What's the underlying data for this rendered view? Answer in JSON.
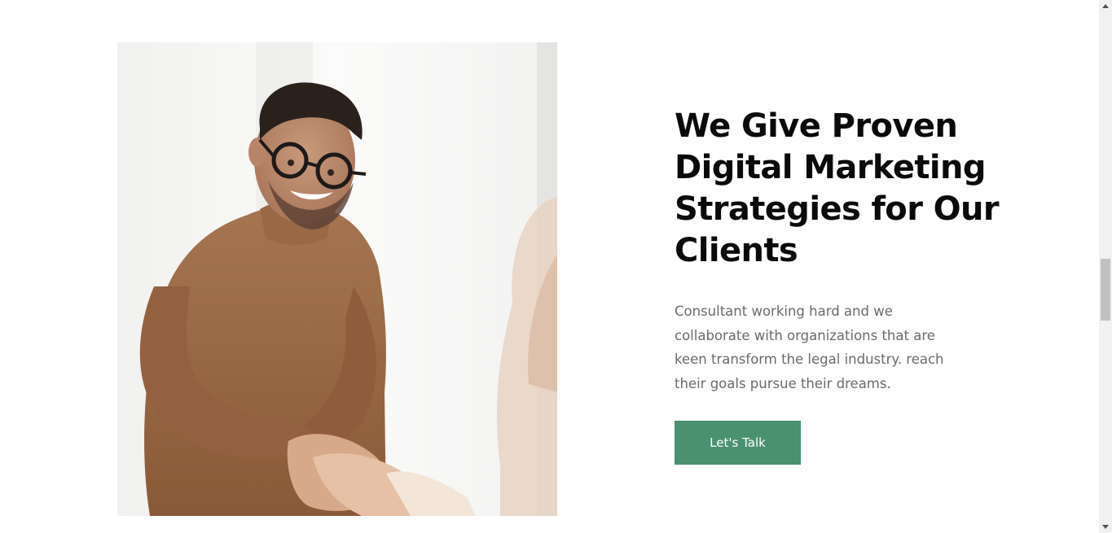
{
  "section": {
    "heading": "We Give Proven Digital Marketing Strategies for Our Clients",
    "description": "Consultant working hard and we collaborate with organizations that are keen transform the legal industry. reach their goals pursue their dreams.",
    "button_label": "Let's Talk"
  },
  "colors": {
    "accent": "#4a9170",
    "heading": "#0a0a0a",
    "body_text": "#6b6b6b",
    "sweater": "#9c6a44"
  },
  "image": {
    "subject": "consultant-handshake-photo"
  }
}
